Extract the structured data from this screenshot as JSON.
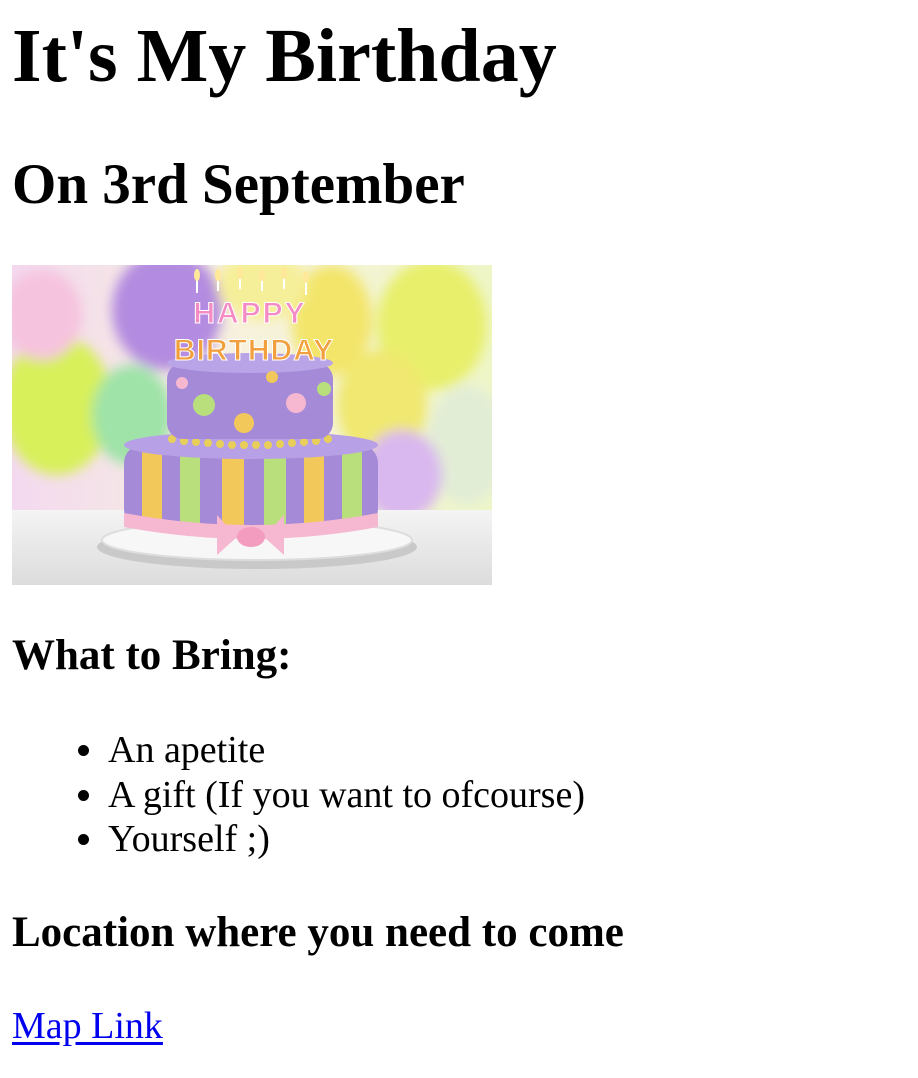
{
  "title": "It's My Birthday",
  "subtitle": "On 3rd September",
  "image": {
    "alt": "Birthday cake",
    "candle_text_top": "HAPPY",
    "candle_text_bottom": "BIRTHDAY"
  },
  "bring": {
    "heading": "What to Bring:",
    "items": [
      {
        "label": "An apetite"
      },
      {
        "label": "A gift (If you want to ofcourse)"
      },
      {
        "label": "Yourself ;)"
      }
    ]
  },
  "location": {
    "heading": "Location where you need to come",
    "link_label": "Map Link"
  },
  "colors": {
    "text": "#000000",
    "link": "#0000ee",
    "background": "#ffffff"
  }
}
